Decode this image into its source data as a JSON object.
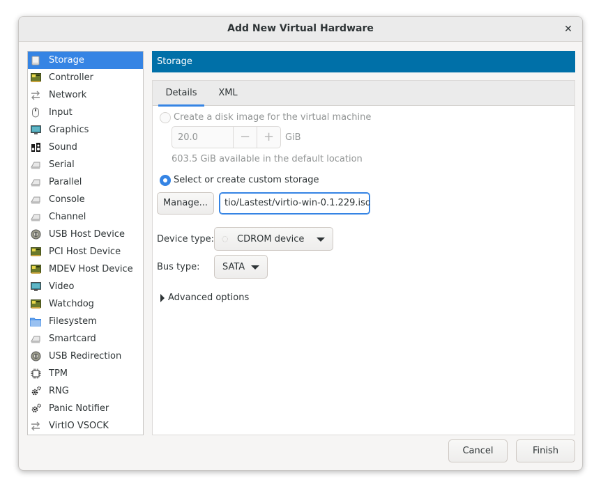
{
  "window": {
    "title": "Add New Virtual Hardware",
    "close_glyph": "✕"
  },
  "sidebar": {
    "items": [
      {
        "label": "Storage",
        "icon": "disk-icon"
      },
      {
        "label": "Controller",
        "icon": "card-icon"
      },
      {
        "label": "Network",
        "icon": "network-icon"
      },
      {
        "label": "Input",
        "icon": "mouse-icon"
      },
      {
        "label": "Graphics",
        "icon": "monitor-icon"
      },
      {
        "label": "Sound",
        "icon": "sound-icon"
      },
      {
        "label": "Serial",
        "icon": "serial-port-icon"
      },
      {
        "label": "Parallel",
        "icon": "serial-port-icon"
      },
      {
        "label": "Console",
        "icon": "serial-port-icon"
      },
      {
        "label": "Channel",
        "icon": "serial-port-icon"
      },
      {
        "label": "USB Host Device",
        "icon": "usb-icon"
      },
      {
        "label": "PCI Host Device",
        "icon": "card-icon"
      },
      {
        "label": "MDEV Host Device",
        "icon": "card-icon"
      },
      {
        "label": "Video",
        "icon": "monitor-icon"
      },
      {
        "label": "Watchdog",
        "icon": "card-icon"
      },
      {
        "label": "Filesystem",
        "icon": "folder-icon"
      },
      {
        "label": "Smartcard",
        "icon": "serial-port-icon"
      },
      {
        "label": "USB Redirection",
        "icon": "usb-icon"
      },
      {
        "label": "TPM",
        "icon": "chip-icon"
      },
      {
        "label": "RNG",
        "icon": "gear-icon"
      },
      {
        "label": "Panic Notifier",
        "icon": "gear-icon"
      },
      {
        "label": "VirtIO VSOCK",
        "icon": "network-icon"
      }
    ],
    "selected_index": 0
  },
  "header": {
    "title": "Storage",
    "color": "#0070a8"
  },
  "tabs": [
    {
      "label": "Details"
    },
    {
      "label": "XML"
    }
  ],
  "details": {
    "create_disk_label": "Create a disk image for the virtual machine",
    "disk_size_value": "20.0",
    "disk_unit": "GiB",
    "available_text": "603.5 GiB available in the default location",
    "custom_storage_label": "Select or create custom storage",
    "manage_button": "Manage...",
    "storage_path": "tio/Lastest/virtio-win-0.1.229.iso",
    "device_type_label": "Device type:",
    "device_type_value": "CDROM device",
    "bus_type_label": "Bus type:",
    "bus_type_value": "SATA",
    "advanced_label": "Advanced options"
  },
  "footer": {
    "cancel": "Cancel",
    "finish": "Finish"
  },
  "colors": {
    "accent": "#3584e4"
  }
}
